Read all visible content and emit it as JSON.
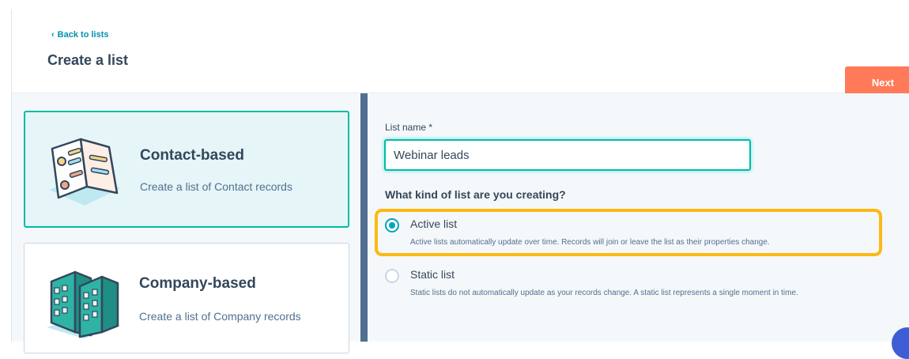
{
  "header": {
    "back_link": "Back to lists",
    "title": "Create a list",
    "next_button": "Next"
  },
  "cards": [
    {
      "title": "Contact-based",
      "description": "Create a list of Contact records",
      "icon": "contact-cards-icon",
      "selected": true
    },
    {
      "title": "Company-based",
      "description": "Create a list of Company records",
      "icon": "company-building-icon",
      "selected": false
    }
  ],
  "form": {
    "list_name_label": "List name *",
    "list_name_value": "Webinar leads",
    "kind_question": "What kind of list are you creating?",
    "options": [
      {
        "label": "Active list",
        "description": "Active lists automatically update over time. Records will join or leave the list as their properties change.",
        "selected": true
      },
      {
        "label": "Static list",
        "description": "Static lists do not automatically update as your records change. A static list represents a single moment in time.",
        "selected": false
      }
    ]
  },
  "colors": {
    "accent": "#00bda5",
    "primary_button": "#ff7a59",
    "highlight": "#fdb913",
    "link": "#0091ae"
  }
}
